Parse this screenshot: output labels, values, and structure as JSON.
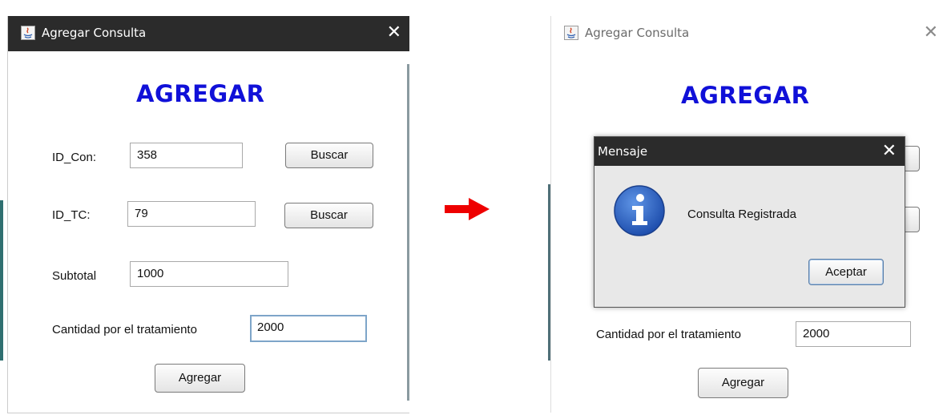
{
  "left_window": {
    "title": "Agregar Consulta",
    "close_glyph": "✕",
    "heading": "AGREGAR",
    "fields": {
      "id_con": {
        "label": "ID_Con:",
        "value": "358"
      },
      "id_tc": {
        "label": "ID_TC:",
        "value": "79"
      },
      "subtotal": {
        "label": "Subtotal",
        "value": "1000"
      },
      "cantidad": {
        "label": "Cantidad por el tratamiento",
        "value": "2000"
      }
    },
    "buscar_label": "Buscar",
    "agregar_label": "Agregar"
  },
  "arrow": {
    "color": "#ee0000",
    "icon": "arrow-right-icon"
  },
  "right_window": {
    "title": "Agregar Consulta",
    "close_glyph": "✕",
    "heading": "AGREGAR",
    "cantidad_label": "Cantidad por el tratamiento",
    "cantidad_value": "2000",
    "agregar_label": "Agregar"
  },
  "message_dialog": {
    "title": "Mensaje",
    "close_glyph": "✕",
    "icon": "info-icon",
    "message": "Consulta Registrada",
    "ok_label": "Aceptar"
  },
  "colors": {
    "heading": "#1010d8",
    "titlebar": "#2b2b2b",
    "info_blue": "#2b62c6"
  }
}
